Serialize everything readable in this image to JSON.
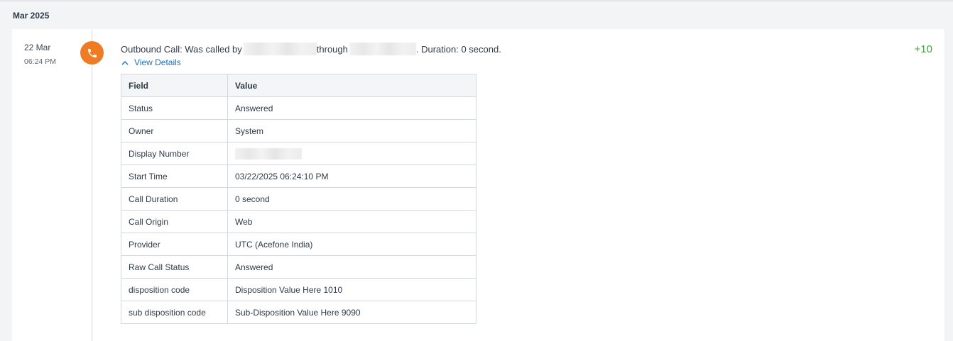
{
  "timeline": {
    "month_label": "Mar 2025",
    "entry": {
      "date": "22 Mar",
      "time": "06:24 PM",
      "icon": "phone-icon",
      "icon_color": "#ef7b24",
      "summary_prefix": "Outbound Call: Was called by",
      "summary_middle": "through",
      "summary_suffix": ". Duration: 0 second.",
      "view_details_label": "View Details",
      "points": "+10",
      "points_color": "#3aa83a",
      "link_color": "#1a6fc4"
    }
  },
  "details_table": {
    "headers": [
      "Field",
      "Value"
    ],
    "rows": [
      {
        "field": "Status",
        "value": "Answered"
      },
      {
        "field": "Owner",
        "value": "System"
      },
      {
        "field": "Display Number",
        "value": ""
      },
      {
        "field": "Start Time",
        "value": "03/22/2025 06:24:10 PM"
      },
      {
        "field": "Call Duration",
        "value": "0 second"
      },
      {
        "field": "Call Origin",
        "value": "Web"
      },
      {
        "field": "Provider",
        "value": "UTC (Acefone India)"
      },
      {
        "field": "Raw Call Status",
        "value": "Answered"
      },
      {
        "field": "disposition code",
        "value": "Disposition Value Here 1010"
      },
      {
        "field": "sub disposition code",
        "value": "Sub-Disposition Value Here 9090"
      }
    ]
  }
}
